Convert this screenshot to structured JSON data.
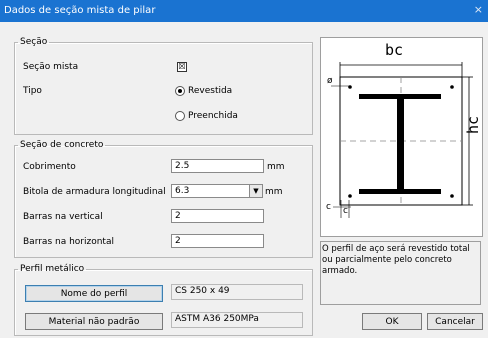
{
  "window": {
    "title": "Dados de seção mista de pilar",
    "close": "×"
  },
  "secao": {
    "legend": "Seção",
    "mista_label": "Seção mista",
    "mista_checked": true,
    "check_mark": "☒",
    "tipo_label": "Tipo",
    "opcoes": [
      "Revestida",
      "Preenchida"
    ],
    "selecionada": "Revestida"
  },
  "concreto": {
    "legend": "Seção de concreto",
    "cobrimento_label": "Cobrimento",
    "cobrimento_value": "2.5",
    "cobrimento_unit": "mm",
    "bitola_label": "Bitola de armadura longitudinal",
    "bitola_value": "6.3",
    "bitola_unit": "mm",
    "barras_vertical_label": "Barras na vertical",
    "barras_vertical_value": "2",
    "barras_horizontal_label": "Barras na horizontal",
    "barras_horizontal_value": "2"
  },
  "perfil": {
    "legend": "Perfil metálico",
    "nome_button": "Nome do perfil",
    "nome_value": "CS 250 x 49",
    "material_button": "Material não padrão",
    "material_value": "ASTM A36 250MPa"
  },
  "diagram": {
    "bc": "bc",
    "hc": "hc",
    "phi": "ø",
    "c": "c"
  },
  "info_text": "O perfil de aço será revestido total ou parcialmente pelo concreto armado.",
  "buttons": {
    "ok": "OK",
    "cancel": "Cancelar"
  },
  "icons": {
    "dropdown": "▼",
    "close": "close-icon"
  }
}
